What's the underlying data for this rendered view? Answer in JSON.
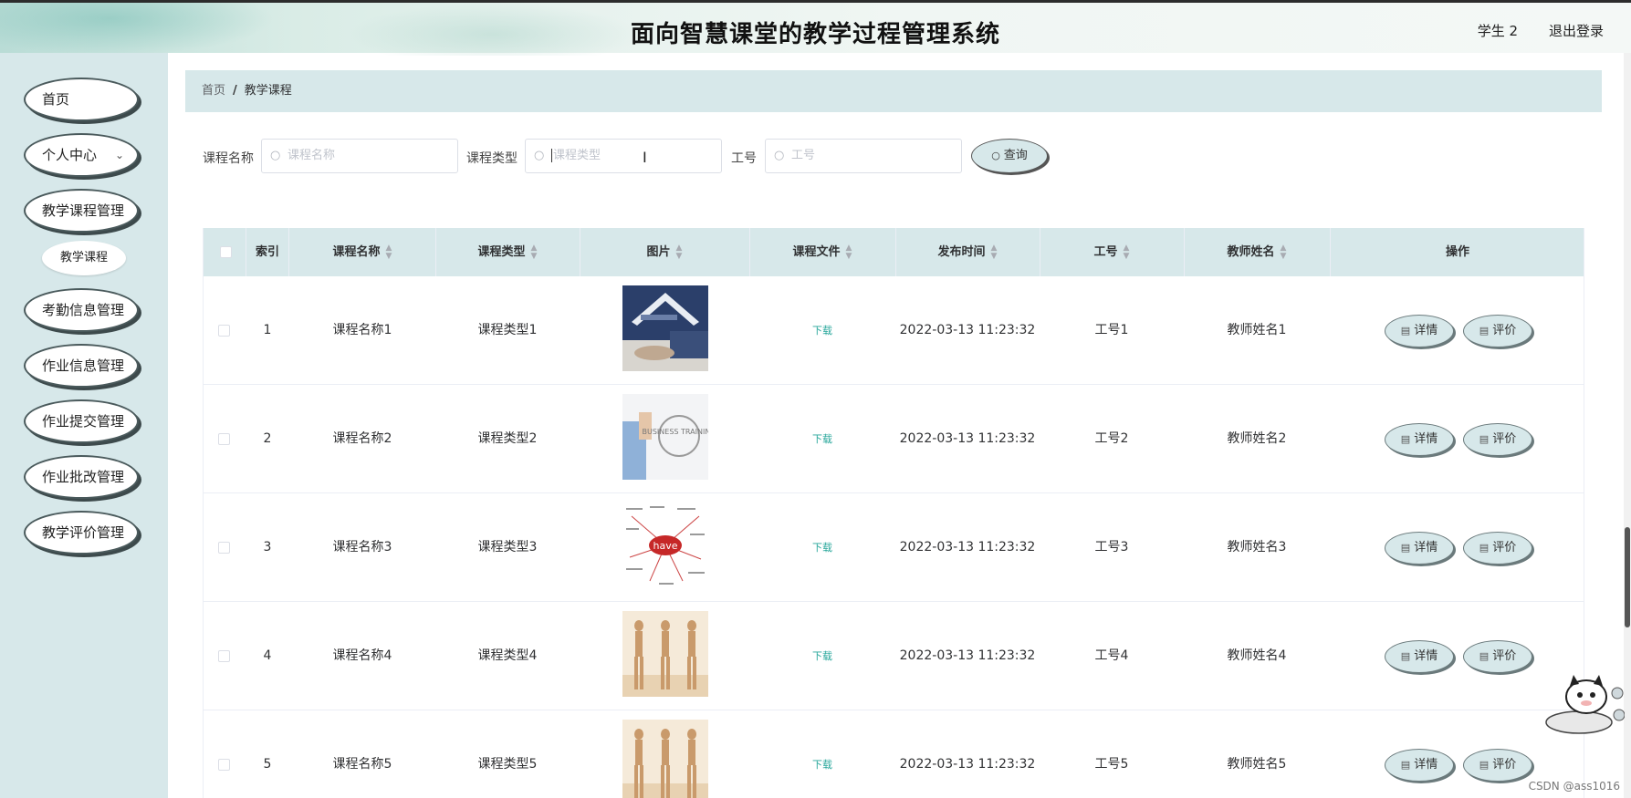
{
  "header": {
    "title": "面向智慧课堂的教学过程管理系统",
    "user": "学生 2",
    "logout": "退出登录"
  },
  "sidebar": {
    "items": [
      {
        "label": "首页"
      },
      {
        "label": "个人中心",
        "chevron": "⌄"
      },
      {
        "label": "教学课程管理"
      },
      {
        "label": "考勤信息管理"
      },
      {
        "label": "作业信息管理"
      },
      {
        "label": "作业提交管理"
      },
      {
        "label": "作业批改管理"
      },
      {
        "label": "教学评价管理"
      }
    ],
    "sub_item": {
      "label": "教学课程"
    }
  },
  "breadcrumb": {
    "home": "首页",
    "sep": "/",
    "current": "教学课程"
  },
  "search": {
    "course_name_label": "课程名称",
    "course_name_placeholder": "课程名称",
    "course_type_label": "课程类型",
    "course_type_placeholder": "课程类型",
    "job_no_label": "工号",
    "job_no_placeholder": "工号",
    "query_button": "查询"
  },
  "table": {
    "headers": {
      "index": "索引",
      "course_name": "课程名称",
      "course_type": "课程类型",
      "image": "图片",
      "course_file": "课程文件",
      "publish_time": "发布时间",
      "job_no": "工号",
      "teacher_name": "教师姓名",
      "actions": "操作"
    },
    "rows": [
      {
        "index": "1",
        "course_name": "课程名称1",
        "course_type": "课程类型1",
        "file": "下载",
        "time": "2022-03-13 11:23:32",
        "job_no": "工号1",
        "teacher": "教师姓名1",
        "detail": "详情",
        "evaluate": "评价"
      },
      {
        "index": "2",
        "course_name": "课程名称2",
        "course_type": "课程类型2",
        "file": "下载",
        "time": "2022-03-13 11:23:32",
        "job_no": "工号2",
        "teacher": "教师姓名2",
        "detail": "详情",
        "evaluate": "评价"
      },
      {
        "index": "3",
        "course_name": "课程名称3",
        "course_type": "课程类型3",
        "file": "下载",
        "time": "2022-03-13 11:23:32",
        "job_no": "工号3",
        "teacher": "教师姓名3",
        "detail": "详情",
        "evaluate": "评价"
      },
      {
        "index": "4",
        "course_name": "课程名称4",
        "course_type": "课程类型4",
        "file": "下载",
        "time": "2022-03-13 11:23:32",
        "job_no": "工号4",
        "teacher": "教师姓名4",
        "detail": "详情",
        "evaluate": "评价"
      },
      {
        "index": "5",
        "course_name": "课程名称5",
        "course_type": "课程类型5",
        "file": "下载",
        "time": "2022-03-13 11:23:32",
        "job_no": "工号5",
        "teacher": "教师姓名5",
        "detail": "详情",
        "evaluate": "评价"
      }
    ],
    "thumb_texts": {
      "row2": "BUSINESS TRAINING",
      "row3": "have"
    }
  },
  "colors": {
    "accent": "#d7e8ea",
    "link": "#26a69a",
    "header_text": "#111111"
  },
  "watermark": "CSDN @ass1016"
}
